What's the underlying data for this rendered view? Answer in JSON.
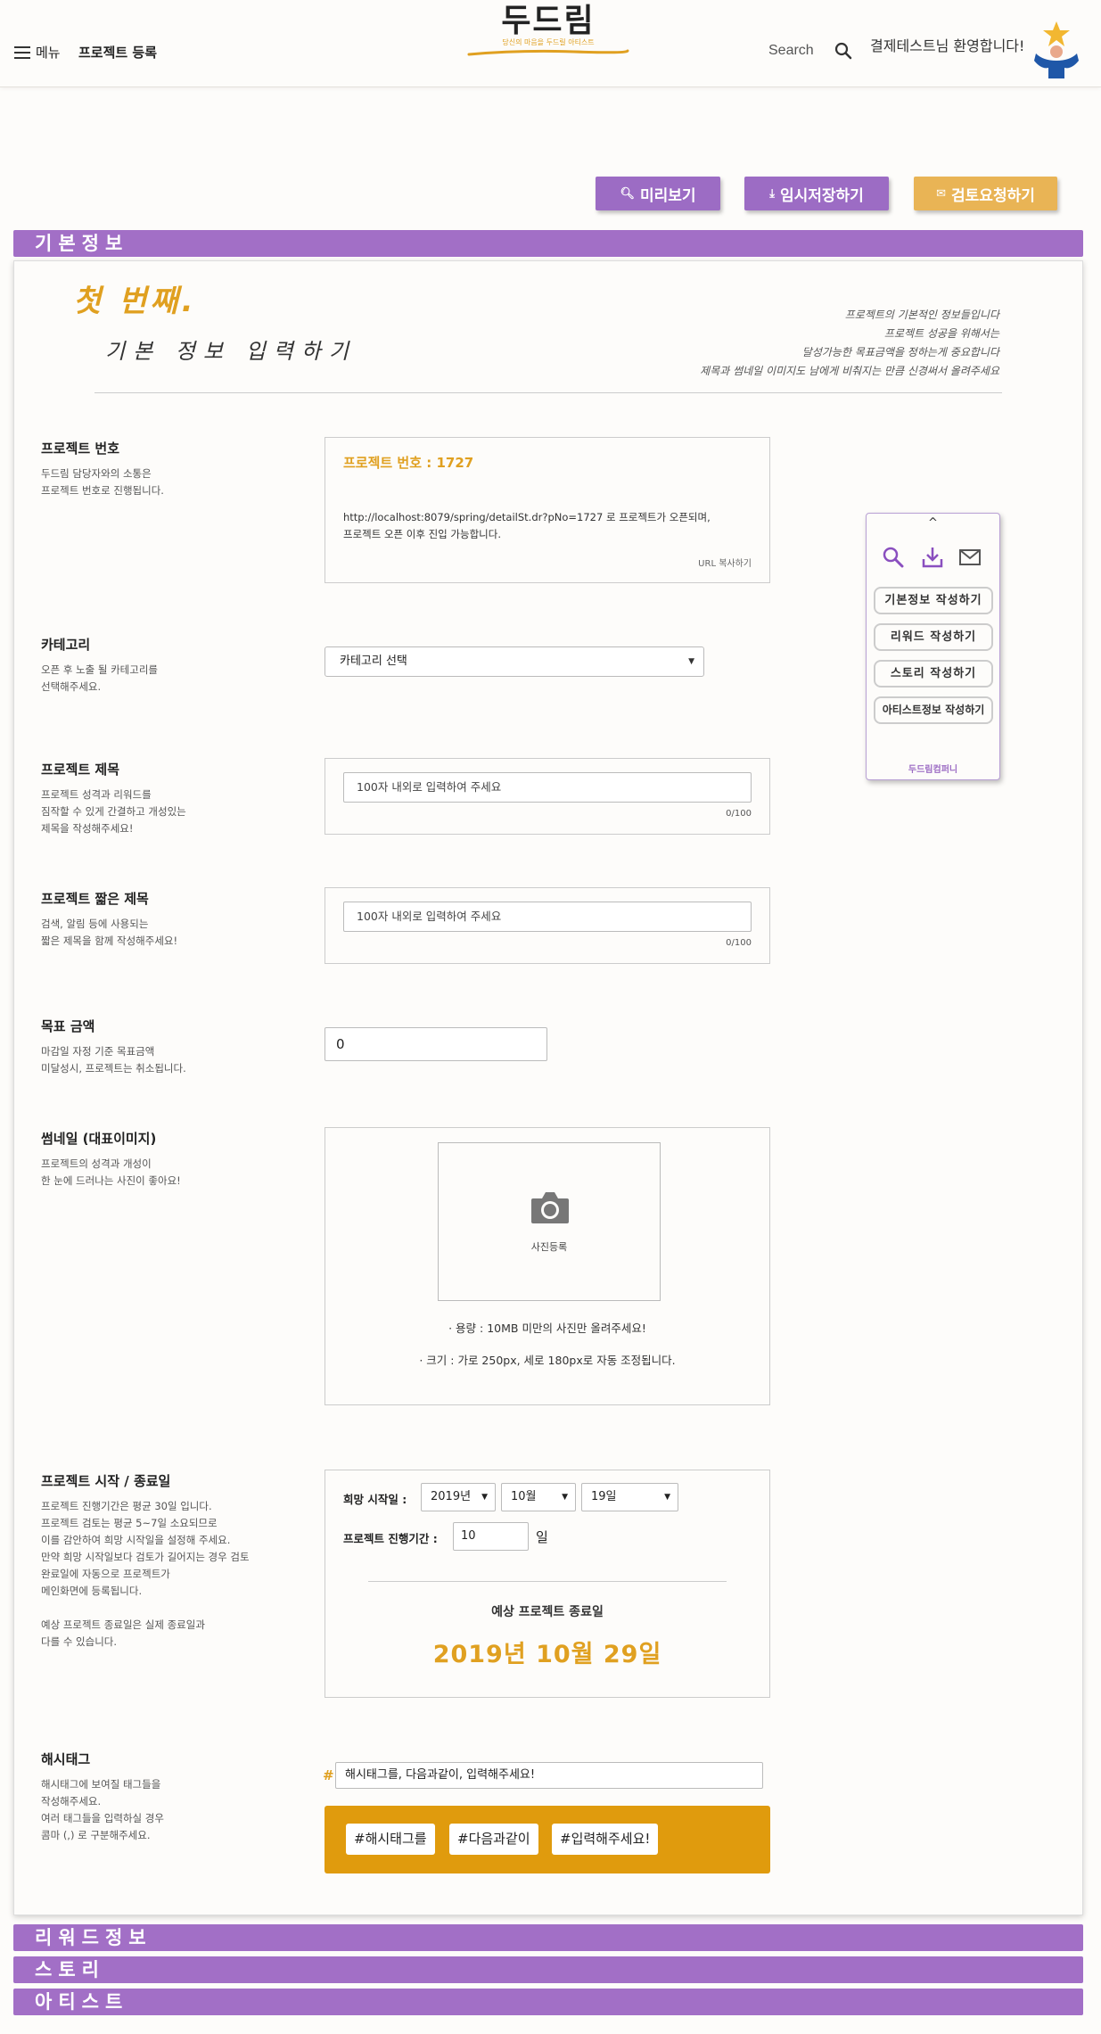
{
  "header": {
    "menu_label": "메뉴",
    "project_register": "프로젝트 등록",
    "logo_title": "두드림",
    "logo_subtitle": "당신의 마음을 두드릴 아티스트",
    "search_label": "Search",
    "welcome": "결제테스트님 환영합니다!"
  },
  "actions": {
    "preview": "미리보기",
    "temp_save": "임시저장하기",
    "request_review": "검토요청하기"
  },
  "sections": {
    "basic": "기본정보",
    "reward": "리워드정보",
    "story": "스토리",
    "artist": "아티스트"
  },
  "intro": {
    "first": "첫 번째.",
    "title": "기본 정보 입력하기",
    "desc": "프로젝트의 기본적인 정보들입니다\n프로젝트 성공을 위해서는\n달성가능한 목표금액을 정하는게 중요합니다\n제목과 썸네일 이미지도 남에게 비춰지는 만큼 신경써서 올려주세요"
  },
  "project_number": {
    "label": "프로젝트 번호",
    "desc": "두드림 담당자와의 소통은\n프로젝트 번호로 진행됩니다.",
    "value_text": "프로젝트 번호 : 1727",
    "url_text": "http://localhost:8079/spring/detailSt.dr?pNo=1727 로 프로젝트가 오픈되며,\n프로젝트 오픈 이후 진입 가능합니다.",
    "copy": "URL 복사하기"
  },
  "category": {
    "label": "카테고리",
    "desc": "오픈 후 노출 될 카테고리를\n선택해주세요.",
    "selected": "카테고리 선택"
  },
  "title_field": {
    "label": "프로젝트 제목",
    "desc": "프로젝트 성격과 리워드를\n짐작할 수 있게 간결하고 개성있는\n제목을 작성해주세요!",
    "placeholder": "100자 내외로 입력하여 주세요",
    "counter": "0/100"
  },
  "short_title": {
    "label": "프로젝트 짧은 제목",
    "desc": "검색, 알림 등에 사용되는\n짧은 제목을 함께 작성해주세요!",
    "placeholder": "100자 내외로 입력하여 주세요",
    "counter": "0/100"
  },
  "goal": {
    "label": "목표 금액",
    "desc": "마감일 자정 기준 목표금액\n미달성시, 프로젝트는 취소됩니다.",
    "value": "0"
  },
  "thumbnail": {
    "label": "썸네일 (대표이미지)",
    "desc": "프로젝트의 성격과 개성이\n한 눈에 드러나는 사진이 좋아요!",
    "register": "사진등록",
    "note_size": "· 용량 : 10MB 미만의 사진만 올려주세요!",
    "note_dim": "· 크기 : 가로 250px, 세로 180px로 자동 조정됩니다."
  },
  "schedule": {
    "label": "프로젝트 시작 / 종료일",
    "desc": "프로젝트 진행기간은 평균 30일 입니다.\n프로젝트 검토는 평균 5~7일 소요되므로\n이를 감안하여 희망 시작일을 설정해 주세요.\n만약 희망 시작일보다 검토가 길어지는 경우 검토\n완료일에 자동으로 프로젝트가\n메인화면에 등록됩니다.\n\n예상 프로젝트 종료일은 실제 종료일과\n다를 수 있습니다.",
    "start_label": "희망 시작일 :",
    "year": "2019년",
    "month": "10월",
    "day": "19일",
    "duration_label": "프로젝트 진행기간 :",
    "duration": "10",
    "duration_unit": "일",
    "end_label": "예상 프로젝트 종료일",
    "end_date": "2019년 10월 29일"
  },
  "hashtag": {
    "label": "해시태그",
    "desc": "해시태그에 보여질 태그들을\n작성해주세요.\n여러 태그들을 입력하실 경우\n콤마 (,) 로 구분해주세요.",
    "mark": "#",
    "placeholder": "해시태그를, 다음과같이, 입력해주세요!",
    "tags": [
      "#해시태그를",
      "#다음과같이",
      "#입력해주세요!"
    ]
  },
  "widget": {
    "up": "^",
    "basic": "기본정보 작성하기",
    "reward": "리워드 작성하기",
    "story": "스토리 작성하기",
    "artist": "아티스트정보 작성하기",
    "footer": "두드림컴퍼니"
  },
  "colors": {
    "purple": "#a26fc6",
    "orange": "#e0a020",
    "review_button": "#e9b455"
  }
}
